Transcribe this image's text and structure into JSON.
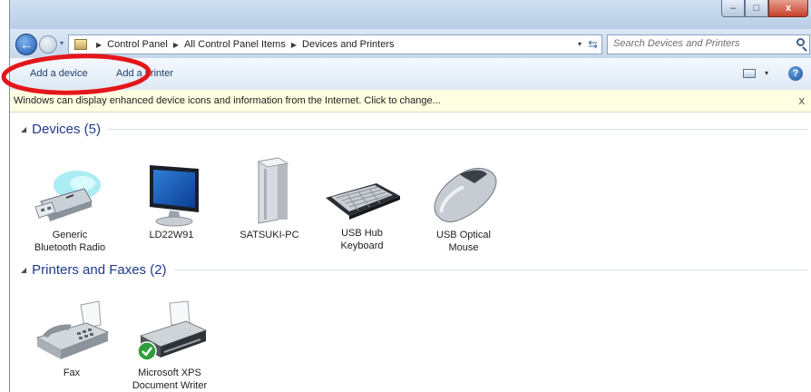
{
  "window": {
    "caption_buttons": {
      "minimize_glyph": "–",
      "maximize_glyph": "□",
      "close_glyph": "x"
    }
  },
  "nav": {
    "back_glyph": "←",
    "history_dropdown_glyph": "▾",
    "breadcrumb": [
      "Control Panel",
      "All Control Panel Items",
      "Devices and Printers"
    ],
    "breadcrumb_separator": "▶",
    "address_dropdown_glyph": "▾",
    "refresh_glyph": "⇆",
    "search_placeholder": "Search Devices and Printers"
  },
  "toolbar": {
    "add_device_label": "Add a device",
    "add_printer_label": "Add a printer",
    "view_dropdown_glyph": "▾",
    "help_glyph": "?"
  },
  "infobar": {
    "text": "Windows can display enhanced device icons and information from the Internet. Click to change...",
    "close_glyph": "x"
  },
  "groups": {
    "devices": {
      "title": "Devices (5)",
      "collapse_glyph": "◢",
      "items": [
        {
          "label_line1": "Generic",
          "label_line2": "Bluetooth Radio",
          "icon": "usb-bluetooth-adapter-icon"
        },
        {
          "label_line1": "LD22W91",
          "label_line2": "",
          "icon": "monitor-icon"
        },
        {
          "label_line1": "SATSUKI-PC",
          "label_line2": "",
          "icon": "computer-tower-icon"
        },
        {
          "label_line1": "USB Hub",
          "label_line2": "Keyboard",
          "icon": "keyboard-icon"
        },
        {
          "label_line1": "USB Optical",
          "label_line2": "Mouse",
          "icon": "mouse-icon"
        }
      ]
    },
    "printers": {
      "title": "Printers and Faxes (2)",
      "collapse_glyph": "◢",
      "items": [
        {
          "label_line1": "Fax",
          "label_line2": "",
          "icon": "fax-machine-icon"
        },
        {
          "label_line1": "Microsoft XPS",
          "label_line2": "Document Writer",
          "icon": "printer-icon",
          "badge": "default-printer-check-icon"
        }
      ]
    }
  },
  "colors": {
    "annotation_ring": "#e4161b",
    "group_title": "#1e3b8c",
    "infobar_background": "#ffffe1",
    "default_badge": "#2f9d3a"
  }
}
